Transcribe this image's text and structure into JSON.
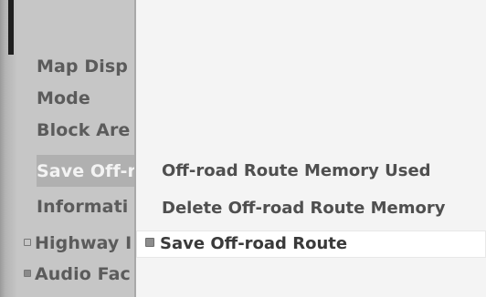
{
  "left_menu": {
    "items": [
      {
        "label": "Map Disp"
      },
      {
        "label": "Mode"
      },
      {
        "label": "Block Are"
      },
      {
        "label": "Save Off-r"
      },
      {
        "label": "Informati"
      },
      {
        "label": "Highway I"
      },
      {
        "label": "Audio Fac"
      }
    ]
  },
  "submenu": {
    "items": [
      {
        "label": "Off-road Route Memory Used"
      },
      {
        "label": "Delete Off-road Route Memory"
      },
      {
        "label": "Save Off-road Route"
      }
    ]
  },
  "colors": {
    "left_menu_bg": "#c6c6c6",
    "submenu_bg": "#f4f4f4",
    "highlight_text": "#f3f3f3",
    "text": "#5b5b5b"
  }
}
